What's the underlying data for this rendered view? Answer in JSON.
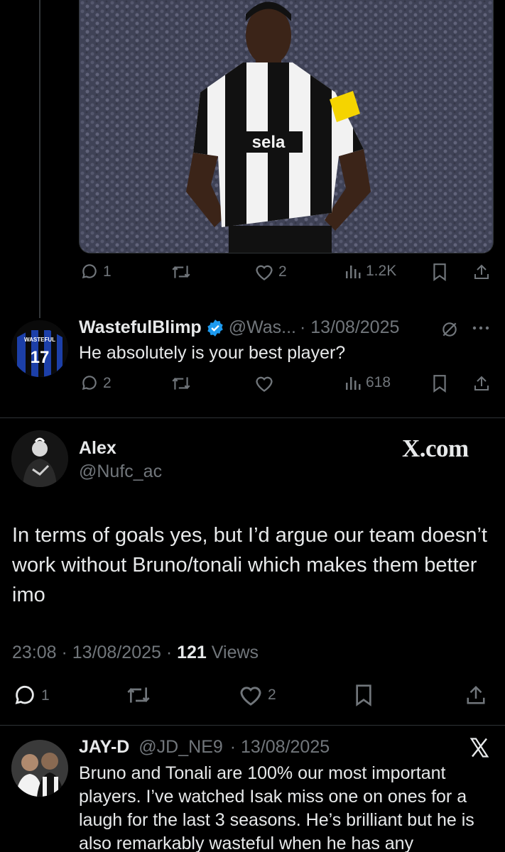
{
  "top_tweet": {
    "media": {
      "alt": "player-photo",
      "sponsor_text": "sela"
    },
    "actions": {
      "replies": "1",
      "likes": "2",
      "views": "1.2K"
    }
  },
  "reply1": {
    "name": "WastefulBlimp",
    "handle": "@Was...",
    "date": "· 13/08/2025",
    "text": "He absolutely is your best player?",
    "avatar_text": "WASTEFUL",
    "avatar_number": "17",
    "actions": {
      "replies": "2",
      "views": "618"
    }
  },
  "main_tweet": {
    "name": "Alex",
    "handle": "@Nufc_ac",
    "brand": "X.com",
    "text": "In terms of goals yes, but I’d argue our team doesn’t work without Bruno/tonali which makes them better imo",
    "time": "23:08 · 13/08/2025 · ",
    "views_count": "121",
    "views_label": " Views",
    "actions": {
      "replies": "1",
      "likes": "2"
    }
  },
  "reply2": {
    "name": "JAY-D",
    "handle": "@JD_NE9",
    "date": "· 13/08/2025",
    "text": "Bruno and Tonali are 100% our most important players. I’ve watched Isak miss one on ones for a laugh for the last 3 seasons. He’s brilliant but he is also remarkably wasteful when he has any"
  },
  "colors": {
    "background": "#000000",
    "text": "#e7e9ea",
    "muted": "#71767b",
    "verified": "#1d9bf0",
    "divider": "#2f3336"
  }
}
